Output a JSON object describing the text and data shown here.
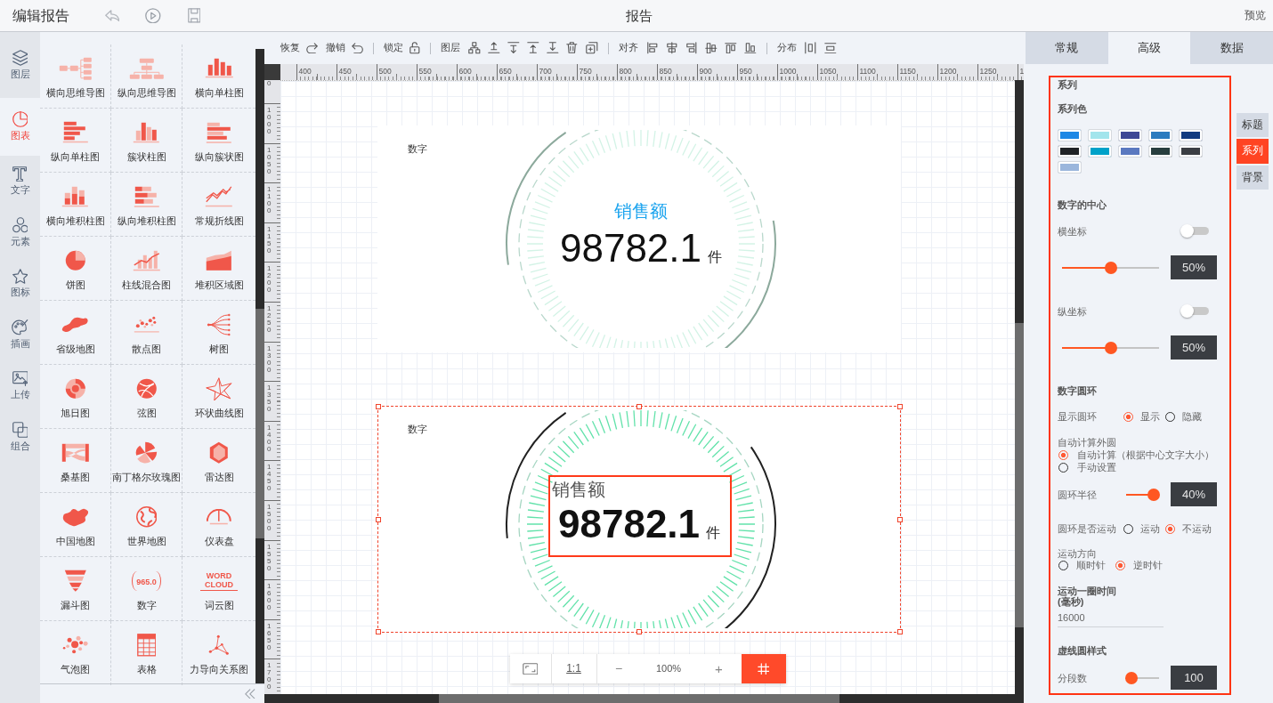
{
  "app_bar": {
    "title": "编辑报告",
    "document_title": "报告",
    "preview": "预览"
  },
  "rail": [
    {
      "label": "图层",
      "selected": false
    },
    {
      "label": "图表",
      "selected": true
    },
    {
      "label": "文字",
      "selected": false
    },
    {
      "label": "元素",
      "selected": false
    },
    {
      "label": "图标",
      "selected": false
    },
    {
      "label": "插画",
      "selected": false
    },
    {
      "label": "上传",
      "selected": false
    },
    {
      "label": "组合",
      "selected": false
    }
  ],
  "palette": [
    {
      "items": [
        {
          "label": "横向思维导图"
        },
        {
          "label": "纵向思维导图"
        },
        {
          "label": "横向单柱图"
        }
      ]
    },
    {
      "items": [
        {
          "label": "纵向单柱图"
        },
        {
          "label": "簇状柱图"
        },
        {
          "label": "纵向簇状图"
        }
      ]
    },
    {
      "items": [
        {
          "label": "横向堆积柱图"
        },
        {
          "label": "纵向堆积柱图"
        },
        {
          "label": "常规折线图"
        }
      ]
    },
    {
      "items": [
        {
          "label": "饼图"
        },
        {
          "label": "柱线混合图"
        },
        {
          "label": "堆积区域图"
        }
      ]
    },
    {
      "items": [
        {
          "label": "省级地图"
        },
        {
          "label": "散点图"
        },
        {
          "label": "树图"
        }
      ]
    },
    {
      "items": [
        {
          "label": "旭日图"
        },
        {
          "label": "弦图"
        },
        {
          "label": "环状曲线图"
        }
      ]
    },
    {
      "items": [
        {
          "label": "桑基图"
        },
        {
          "label": "南丁格尔玫瑰图"
        },
        {
          "label": "雷达图"
        }
      ]
    },
    {
      "items": [
        {
          "label": "中国地图"
        },
        {
          "label": "世界地图"
        },
        {
          "label": "仪表盘"
        }
      ]
    },
    {
      "items": [
        {
          "label": "漏斗图"
        },
        {
          "label": "数字",
          "preview_text": "965.0"
        },
        {
          "label": "词云图",
          "preview_text": "WORD CLOUD"
        }
      ]
    },
    {
      "items": [
        {
          "label": "气泡图"
        },
        {
          "label": "表格"
        },
        {
          "label": "力导向关系图"
        }
      ]
    }
  ],
  "toolbar": {
    "history": [
      {
        "label": "恢复"
      },
      {
        "label": "撤销"
      }
    ],
    "lock": {
      "label": "锁定"
    },
    "groups": [
      {
        "label": "图层"
      },
      {
        "label": "对齐"
      },
      {
        "label": "分布"
      }
    ]
  },
  "rulers": {
    "horizontal": [
      "400",
      "450",
      "500",
      "550",
      "600",
      "650",
      "700",
      "750",
      "800",
      "850",
      "900",
      "950",
      "1000",
      "1050",
      "1100",
      "1150",
      "1200",
      "1250",
      "1"
    ],
    "vertical": [
      "0",
      "1000",
      "1050",
      "1100",
      "1150",
      "1200",
      "1250",
      "1300",
      "1350",
      "1400",
      "1450",
      "1500",
      "1550",
      "1600",
      "1650",
      "1700"
    ]
  },
  "canvas": {
    "widgets": [
      {
        "kind": "plain",
        "title": "数字",
        "label": "销售额",
        "value": "98782.1",
        "unit": "件",
        "selected": false,
        "highlighted": false
      },
      {
        "kind": "bold",
        "title": "数字",
        "label": "销售额",
        "value": "98782.1",
        "unit": "件",
        "selected": true,
        "highlighted": true
      }
    ]
  },
  "zoom_bar": {
    "reset": "1:1",
    "zoom_out": "−",
    "level": "100%",
    "zoom_in": "+",
    "grid_on": true
  },
  "panel": {
    "tabs": [
      {
        "label": "常规",
        "selected": false
      },
      {
        "label": "高级",
        "selected": true
      },
      {
        "label": "数据",
        "selected": false
      }
    ],
    "highlighted": true,
    "title": "系列",
    "swatch_label": "系列色",
    "swatches": [
      {
        "color": "#1e88e5"
      },
      {
        "color": "#a2e5ec"
      },
      {
        "color": "#3f4896"
      },
      {
        "color": "#2b7bbf"
      },
      {
        "color": "#123b80"
      },
      {
        "color": "#202326"
      },
      {
        "color": "#00a2c9"
      },
      {
        "color": "#5b79c0"
      },
      {
        "color": "#283e3e"
      },
      {
        "color": "#3b3e43"
      },
      {
        "color": "#9bb6dc"
      }
    ],
    "sections": [
      {
        "heading": "数字的中心",
        "rows": [
          {
            "kind": "toggle",
            "label": "横坐标",
            "on": false
          },
          {
            "kind": "slider",
            "level": 0.5,
            "reading": "50%"
          },
          {
            "kind": "toggle",
            "label": "纵坐标",
            "on": false
          },
          {
            "kind": "slider",
            "level": 0.5,
            "reading": "50%"
          }
        ]
      },
      {
        "heading": "数字圆环",
        "rows": [
          {
            "kind": "inline-radio",
            "label": "显示圆环",
            "options": [
              {
                "label": "显示",
                "selected": true
              },
              {
                "label": "隐藏",
                "selected": false
              }
            ]
          },
          {
            "kind": "stacked-radio",
            "label": "自动计算外圆",
            "options": [
              {
                "label": "自动计算（根据中心文字大小）",
                "selected": true
              },
              {
                "label": "手动设置",
                "selected": false
              }
            ]
          },
          {
            "kind": "slider",
            "label": "圆环半径",
            "level": 0.85,
            "reading": "40%"
          },
          {
            "kind": "inline-radio",
            "label": "圆环是否运动",
            "options": [
              {
                "label": "运动",
                "selected": false
              },
              {
                "label": "不运动",
                "selected": true
              }
            ]
          },
          {
            "kind": "wrapped-radio",
            "label": "运动方向",
            "options": [
              {
                "label": "顺时针",
                "selected": false
              },
              {
                "label": "逆时针",
                "selected": true
              }
            ]
          },
          {
            "kind": "input",
            "label": "运动一圈时间(毫秒)",
            "value": "16000"
          }
        ]
      },
      {
        "heading": "虚线圆样式",
        "rows": [
          {
            "kind": "slider",
            "label": "分段数",
            "level": 0.15,
            "reading": "100"
          }
        ]
      }
    ],
    "side_tabs": [
      {
        "label": "标题",
        "selected": false
      },
      {
        "label": "系列",
        "selected": true
      },
      {
        "label": "背景",
        "selected": false
      }
    ]
  }
}
